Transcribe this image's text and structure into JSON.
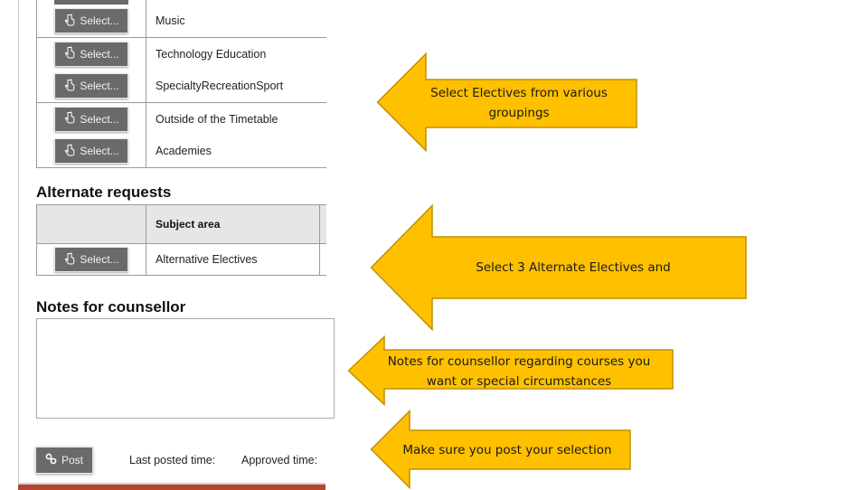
{
  "electives": {
    "select_label": "Select...",
    "rows": [
      {
        "subject": "Music"
      },
      {
        "subject": "Technology Education"
      },
      {
        "subject": "SpecialtyRecreationSport"
      },
      {
        "subject": "Outside of the Timetable"
      },
      {
        "subject": "Academies"
      }
    ]
  },
  "alternate": {
    "title": "Alternate requests",
    "column_header": "Subject area",
    "select_label": "Select...",
    "rows": [
      {
        "subject": "Alternative Electives"
      }
    ]
  },
  "notes": {
    "title": "Notes for counsellor",
    "value": ""
  },
  "footer": {
    "post_label": "Post",
    "last_posted_label": "Last posted time:",
    "approved_label": "Approved time:"
  },
  "callouts": [
    {
      "text": "Select Electives from various groupings"
    },
    {
      "text": "Select 3 Alternate Electives and"
    },
    {
      "text": "Notes for counsellor regarding courses you want or special circumstances"
    },
    {
      "text": "Make sure you post your selection"
    }
  ],
  "colors": {
    "callout_fill": "#FFC000",
    "callout_border": "#BF9000",
    "button_bg": "#6A6A6A",
    "accent_bar": "#B8432E"
  }
}
